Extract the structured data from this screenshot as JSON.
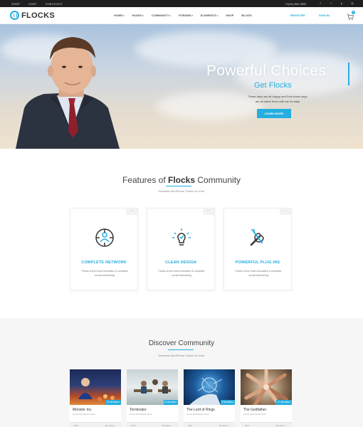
{
  "topbar": {
    "links": [
      "SHOP",
      "CART",
      "CHECKOUT"
    ],
    "phone": "+1(24) 456-7890",
    "social": [
      "facebook-icon",
      "twitter-icon",
      "pinterest-icon",
      "instagram-icon"
    ],
    "social_glyphs": [
      "f",
      "t",
      "p",
      "◎"
    ]
  },
  "header": {
    "logo": "FLOCKS",
    "nav": [
      {
        "label": "HOME",
        "dropdown": true
      },
      {
        "label": "PAGES",
        "dropdown": true
      },
      {
        "label": "COMMUNITY",
        "dropdown": true
      },
      {
        "label": "FORUMS",
        "dropdown": true
      },
      {
        "label": "ELEMENTS",
        "dropdown": true
      },
      {
        "label": "SHOP",
        "dropdown": false
      },
      {
        "label": "BLOGS",
        "dropdown": false
      }
    ],
    "register": "REGISTER",
    "signin": "SIGN IN",
    "cart_count": "0"
  },
  "hero": {
    "title": "Powerful Choices",
    "subtitle": "Get Flocks",
    "desc_line1": "These days are all Happy and Free these days",
    "desc_line2": "are all share them with me oh baby",
    "button": "LEARN MORE"
  },
  "features": {
    "title_prefix": "Features of ",
    "title_brand": "Flocks",
    "title_suffix": " Community",
    "subtitle": "Smartest WordPress Theme for Ever",
    "cards": [
      {
        "name": "COMPLETE NETWORK",
        "desc": "Flocks is the most innovative & complete social networking",
        "icon": "network-icon"
      },
      {
        "name": "CLEAN DESIGN",
        "desc": "Flocks is the most innovative & complete social networking",
        "icon": "lightbulb-icon"
      },
      {
        "name": "POWERFUL PLUG-INS",
        "desc": "Flocks is the most innovative & complete social networking",
        "icon": "wrench-icon"
      }
    ]
  },
  "discover": {
    "title": "Discover Community",
    "subtitle": "Smartest WordPress Theme for Ever",
    "cards": [
      {
        "name": "Monster Inc.",
        "members": "12 Members",
        "desc": "Group Description Here",
        "foot_left": "2017",
        "foot_right": "Members →"
      },
      {
        "name": "Terminator",
        "members": "8 Members",
        "desc": "Group Description Here",
        "foot_left": "2017",
        "foot_right": "Members →"
      },
      {
        "name": "The Lord of Rings",
        "members": "5 Members",
        "desc": "Group Description Here",
        "foot_left": "2017",
        "foot_right": "Members →"
      },
      {
        "name": "The Godfather",
        "members": "17 Members",
        "desc": "Group Description Here",
        "foot_left": "2017",
        "foot_right": "Members →"
      }
    ]
  },
  "colors": {
    "accent": "#25aee0",
    "topbar": "#1f1f1f"
  }
}
